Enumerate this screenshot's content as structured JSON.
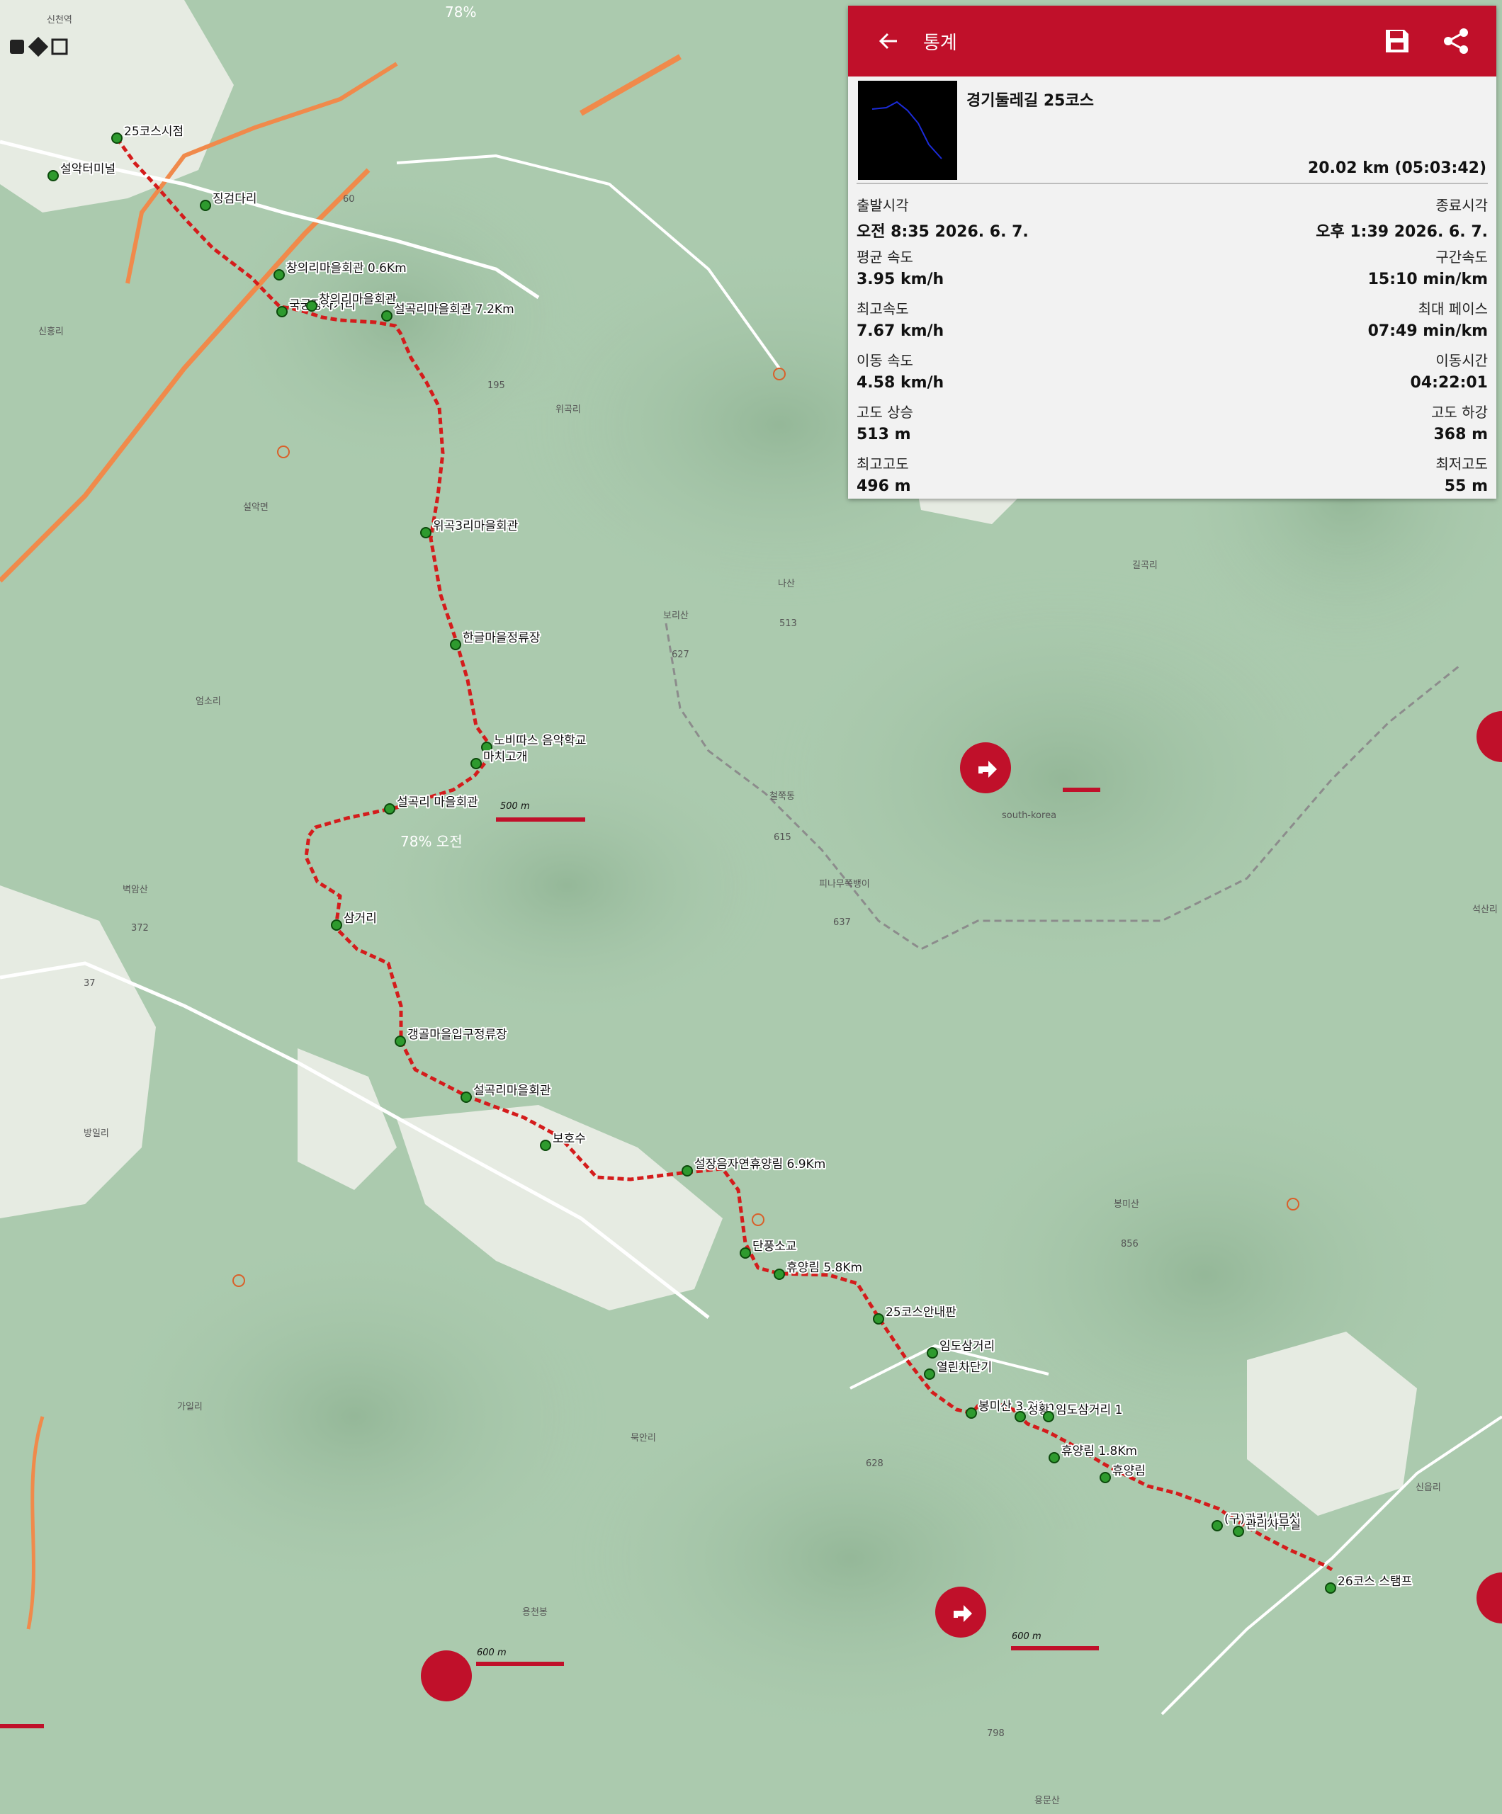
{
  "status_bar": {
    "battery": "78%",
    "duplicate_status": "78% 오전"
  },
  "panel": {
    "title": "통계",
    "back_icon": "arrow-left-icon",
    "save_icon": "save-icon",
    "share_icon": "share-icon",
    "track_name": "경기둘레길 25코스",
    "distance_time": "20.02 km (05:03:42)",
    "stats": [
      {
        "left_label": "출발시각",
        "left_value": "오전 8:35 2026. 6. 7.",
        "right_label": "종료시각",
        "right_value": "오후 1:39 2026. 6. 7."
      },
      {
        "left_label": "평균 속도",
        "left_value": "3.95 km/h",
        "right_label": "구간속도",
        "right_value": "15:10 min/km"
      },
      {
        "left_label": "최고속도",
        "left_value": "7.67 km/h",
        "right_label": "최대 페이스",
        "right_value": "07:49 min/km"
      },
      {
        "left_label": "이동 속도",
        "left_value": "4.58 km/h",
        "right_label": "이동시간",
        "right_value": "04:22:01"
      },
      {
        "left_label": "고도 상승",
        "left_value": "513 m",
        "right_label": "고도 하강",
        "right_value": "368 m"
      },
      {
        "left_label": "최고고도",
        "left_value": "496 m",
        "right_label": "최저고도",
        "right_value": "55 m"
      }
    ]
  },
  "waypoints": [
    "25코스시점",
    "설악터미널",
    "징검다리",
    "창의리마을회관 0.6Km",
    "국궁장사거리",
    "창의리마을회관",
    "설곡리마을회관 7.2Km",
    "위곡3리마을회관",
    "한글마을정류장",
    "노비따스 음악학교",
    "마치고개",
    "설곡리 마을회관",
    "삼거리",
    "갱골마을입구정류장",
    "설곡리마을회관",
    "보호수",
    "설장음자연휴양림 6.9Km",
    "단풍소교",
    "휴양림 5.8Km",
    "25코스안내판",
    "임도삼거리",
    "열린차단기",
    "봉미산 3.3Km",
    "성황",
    "임도삼거리 1",
    "휴양림 1.8Km",
    "휴양림",
    "(구)관리사무실",
    "관리사무실",
    "26코스 스탬프"
  ],
  "map_labels": {
    "places": [
      "신흥리",
      "설악면",
      "위곡리",
      "엄소리",
      "벽암산",
      "방일리",
      "가일리",
      "묵안리",
      "길곡리",
      "봉미산",
      "석산리",
      "신읍리",
      "나산",
      "보리산",
      "철쭉동",
      "피나무쪽뱅이",
      "용천봉",
      "용문산",
      "신천역",
      "south-korea"
    ],
    "peaks": [
      "513",
      "627",
      "615",
      "637",
      "856",
      "628",
      "798",
      "195",
      "372"
    ],
    "roads": [
      "60",
      "37"
    ]
  },
  "scale_bars": [
    "600 m",
    "600 m",
    "500 m"
  ],
  "navigate_icon": "navigate-arrow-icon",
  "colors": {
    "accent": "#c0102a",
    "track": "#d41c1c",
    "waypoint": "#2e9a2e",
    "forest": "#a6c7a8",
    "road": "#f08a4b"
  }
}
